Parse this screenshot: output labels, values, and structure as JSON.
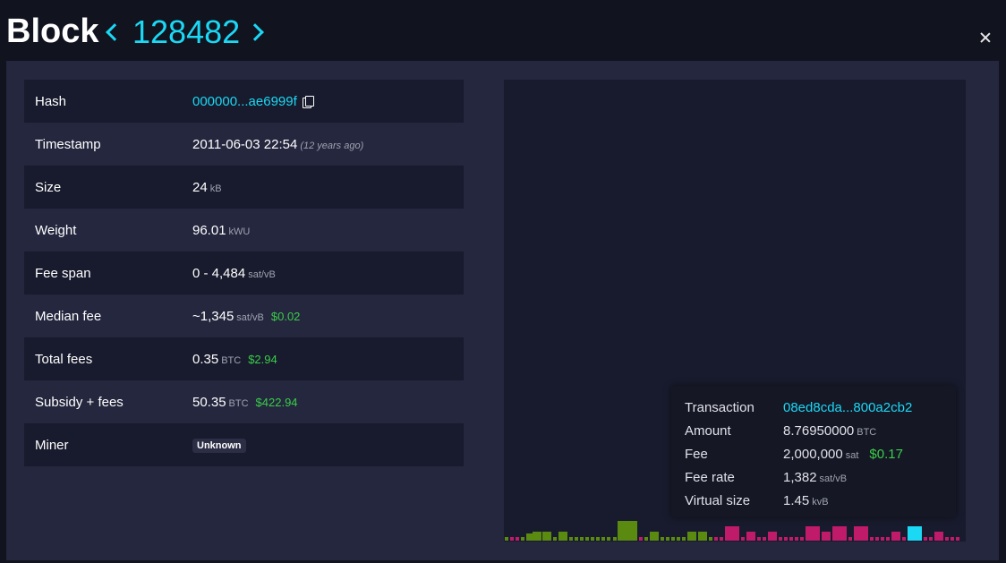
{
  "header": {
    "title": "Block",
    "block_height": "128482"
  },
  "details": [
    {
      "label": "Hash",
      "value": "000000...ae6999f"
    },
    {
      "label": "Timestamp",
      "value": "2011-06-03 22:54",
      "extra": "(12 years ago)"
    },
    {
      "label": "Size",
      "value": "24",
      "unit": "kB"
    },
    {
      "label": "Weight",
      "value": "96.01",
      "unit": "kWU"
    },
    {
      "label": "Fee span",
      "value": "0 - 4,484",
      "unit": "sat/vB"
    },
    {
      "label": "Median fee",
      "value": "~1,345",
      "unit": "sat/vB",
      "fiat": "$0.02"
    },
    {
      "label": "Total fees",
      "value": "0.35",
      "unit": "BTC",
      "fiat": "$2.94"
    },
    {
      "label": "Subsidy + fees",
      "value": "50.35",
      "unit": "BTC",
      "fiat": "$422.94"
    },
    {
      "label": "Miner",
      "value": "Unknown"
    }
  ],
  "tooltip": {
    "transaction_label": "Transaction",
    "transaction_value": "08ed8cda...800a2cb2",
    "amount_label": "Amount",
    "amount_value": "8.76950000",
    "amount_unit": "BTC",
    "fee_label": "Fee",
    "fee_value": "2,000,000",
    "fee_unit": "sat",
    "fee_fiat": "$0.17",
    "feerate_label": "Fee rate",
    "feerate_value": "1,382",
    "feerate_unit": "sat/vB",
    "vsize_label": "Virtual size",
    "vsize_value": "1.45",
    "vsize_unit": "kvB"
  },
  "colors": {
    "accent": "#1bd8f4",
    "fiat": "#3bcc49",
    "low_fee_tx": "#5a8a0f",
    "high_fee_tx": "#c01a6a",
    "selected_tx": "#1bd8f4"
  }
}
